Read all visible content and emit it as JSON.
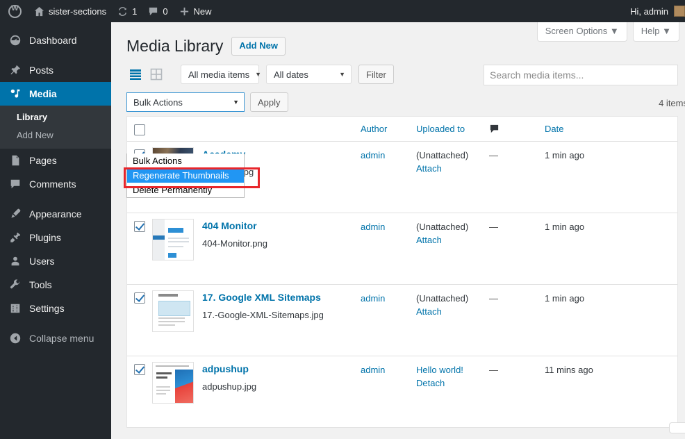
{
  "adminbar": {
    "logo_icon": "wordpress-logo-icon",
    "site_name": "sister-sections",
    "site_icon": "home-icon",
    "updates_icon": "updates-icon",
    "updates_count": "1",
    "comments_icon": "comment-bubble-icon",
    "comments_count": "0",
    "new_icon": "plus-icon",
    "new_label": "New",
    "greeting": "Hi, admin"
  },
  "sidebar": {
    "items": [
      {
        "label": "Dashboard",
        "icon": "dashboard-icon",
        "current": false
      },
      {
        "label": "Posts",
        "icon": "pin-icon",
        "current": false
      },
      {
        "label": "Media",
        "icon": "media-icon",
        "current": true
      },
      {
        "label": "Pages",
        "icon": "pages-icon",
        "current": false
      },
      {
        "label": "Comments",
        "icon": "comment-icon",
        "current": false
      },
      {
        "label": "Appearance",
        "icon": "brush-icon",
        "current": false
      },
      {
        "label": "Plugins",
        "icon": "plug-icon",
        "current": false
      },
      {
        "label": "Users",
        "icon": "user-icon",
        "current": false
      },
      {
        "label": "Tools",
        "icon": "wrench-icon",
        "current": false
      },
      {
        "label": "Settings",
        "icon": "settings-icon",
        "current": false
      }
    ],
    "submenu": [
      {
        "label": "Library",
        "current": true
      },
      {
        "label": "Add New",
        "current": false
      }
    ],
    "collapse_label": "Collapse menu",
    "collapse_icon": "collapse-arrow-icon",
    "highlight_color": "#0073aa"
  },
  "screen_meta": {
    "screen_options": "Screen Options ▼",
    "help": "Help ▼"
  },
  "page": {
    "title": "Media Library",
    "add_new": "Add New"
  },
  "toolbar": {
    "list_view_icon": "list-view-icon",
    "grid_view_icon": "grid-view-icon",
    "media_filter": "All media items",
    "date_filter": "All dates",
    "filter_button": "Filter",
    "caret": "▼"
  },
  "search": {
    "placeholder": "Search media items...",
    "value": ""
  },
  "bulk": {
    "selected": "Bulk Actions",
    "caret": "▼",
    "apply": "Apply",
    "options": [
      {
        "label": "Bulk Actions",
        "selected": false
      },
      {
        "label": "Regenerate Thumbnails",
        "selected": true
      },
      {
        "label": "Delete Permanently",
        "selected": false
      }
    ],
    "highlight_color": "#2196f3",
    "annotation_color": "#e8262b"
  },
  "items_count": "4 items",
  "table": {
    "headers": {
      "author": "Author",
      "parent": "Uploaded to",
      "comments_icon": "comment-bubble-icon",
      "date": "Date"
    },
    "rows": [
      {
        "checked": true,
        "thumb": "academy-thumbnail",
        "title": "Academy",
        "filename": "Academy.jpg",
        "author": "admin",
        "parent": "(Unattached)",
        "parent_action": "Attach",
        "comments": "—",
        "date": "1 min ago"
      },
      {
        "checked": true,
        "thumb": "404-monitor-thumbnail",
        "title": "404 Monitor",
        "filename": "404-Monitor.png",
        "author": "admin",
        "parent": "(Unattached)",
        "parent_action": "Attach",
        "comments": "—",
        "date": "1 min ago"
      },
      {
        "checked": true,
        "thumb": "google-xml-sitemaps-thumbnail",
        "title": "17. Google XML Sitemaps",
        "filename": "17.-Google-XML-Sitemaps.jpg",
        "author": "admin",
        "parent": "(Unattached)",
        "parent_action": "Attach",
        "comments": "—",
        "date": "1 min ago"
      },
      {
        "checked": true,
        "thumb": "adpushup-thumbnail",
        "title": "adpushup",
        "filename": "adpushup.jpg",
        "author": "admin",
        "parent": "Hello world!",
        "parent_action": "Detach",
        "comments": "—",
        "date": "11 mins ago"
      }
    ]
  }
}
